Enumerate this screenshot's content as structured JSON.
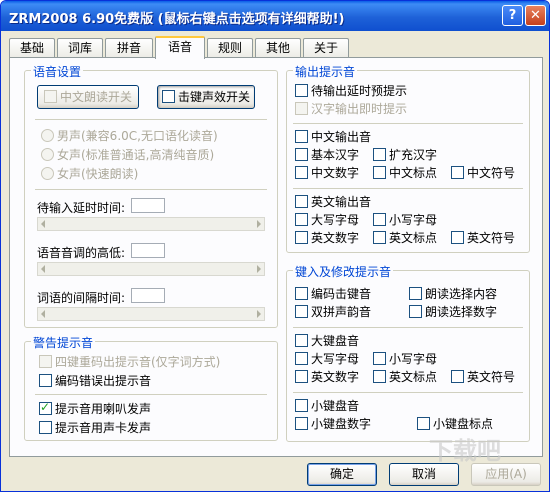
{
  "window": {
    "title": "ZRM2008 6.90免费版 (鼠标右键点击选项有详细帮助!)",
    "help_label": "?",
    "close_label": "✕"
  },
  "tabs": [
    {
      "label": "基础"
    },
    {
      "label": "词库"
    },
    {
      "label": "拼音"
    },
    {
      "label": "语音",
      "active": true
    },
    {
      "label": "规则"
    },
    {
      "label": "其他"
    },
    {
      "label": "关于"
    }
  ],
  "voice_settings": {
    "group_label": "语音设置",
    "read_chinese_switch": "中文朗读开关",
    "keystroke_sound_switch": "击键声效开关",
    "voices": [
      "男声(兼容6.0C,无口语化读音)",
      "女声(标准普通话,高清纯音质)",
      "女声(快速朗读)"
    ],
    "input_delay_label": "待输入延时时间:",
    "pitch_label": "语音音调的高低:",
    "word_gap_label": "词语的间隔时间:"
  },
  "alert_sounds": {
    "group_label": "警告提示音",
    "items": [
      {
        "label": "四键重码出提示音(仅字词方式)",
        "checked": false,
        "disabled": true
      },
      {
        "label": "编码错误出提示音",
        "checked": false
      },
      {
        "label": "提示音用喇叭发声",
        "checked": true
      },
      {
        "label": "提示音用声卡发声",
        "checked": false
      }
    ]
  },
  "output_prompts": {
    "group_label": "输出提示音",
    "pending_delay_prompt": "待输出延时预提示",
    "chinese_immediate_prompt": "汉字输出即时提示",
    "chinese_output_sound": "中文输出音",
    "basic_hanzi": "基本汉字",
    "extended_hanzi": "扩充汉字",
    "chinese_digits": "中文数字",
    "chinese_punct": "中文标点",
    "chinese_symbols": "中文符号",
    "english_output_sound": "英文输出音",
    "uppercase": "大写字母",
    "lowercase": "小写字母",
    "english_digits": "英文数字",
    "english_punct": "英文标点",
    "english_symbols": "英文符号"
  },
  "key_prompts": {
    "group_label": "键入及修改提示音",
    "code_keystroke": "编码击键音",
    "read_selection": "朗读选择内容",
    "double_pinyin": "双拼声韵音",
    "read_selection_digits": "朗读选择数字",
    "main_keyboard": "大键盘音",
    "uppercase": "大写字母",
    "lowercase": "小写字母",
    "english_digits": "英文数字",
    "english_punct": "英文标点",
    "english_symbols": "英文符号",
    "numpad_sound": "小键盘音",
    "numpad_digits": "小键盘数字",
    "numpad_punct": "小键盘标点"
  },
  "footer": {
    "ok": "确定",
    "cancel": "取消",
    "apply": "应用(A)"
  },
  "watermark": "下载吧"
}
